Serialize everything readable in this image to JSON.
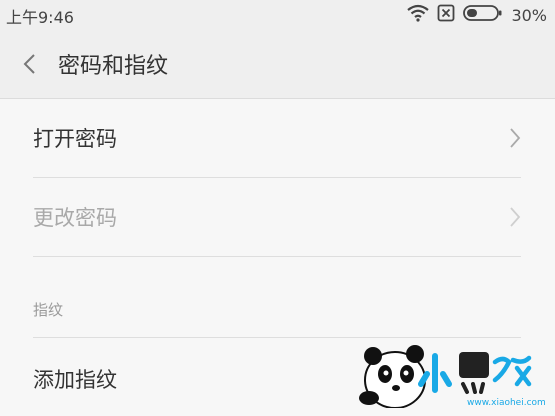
{
  "status_bar": {
    "time": "上午9:46",
    "battery": "30%",
    "icons": [
      "wifi-icon",
      "no-sim-icon",
      "battery-icon"
    ]
  },
  "header": {
    "title": "密码和指纹",
    "back_icon": "chevron-left-icon"
  },
  "rows": [
    {
      "label": "打开密码",
      "enabled": true
    },
    {
      "label": "更改密码",
      "enabled": false
    }
  ],
  "section": {
    "label": "指纹"
  },
  "fingerprint_rows": [
    {
      "label": "添加指纹"
    }
  ],
  "watermark": {
    "brand": "小黑游戏",
    "url": "www.xiaohei.com"
  },
  "colors": {
    "background": "#f7f7f7",
    "header_bg": "#efefef",
    "text": "#333333",
    "disabled_text": "#a9a9a9",
    "divider": "#dedede"
  }
}
